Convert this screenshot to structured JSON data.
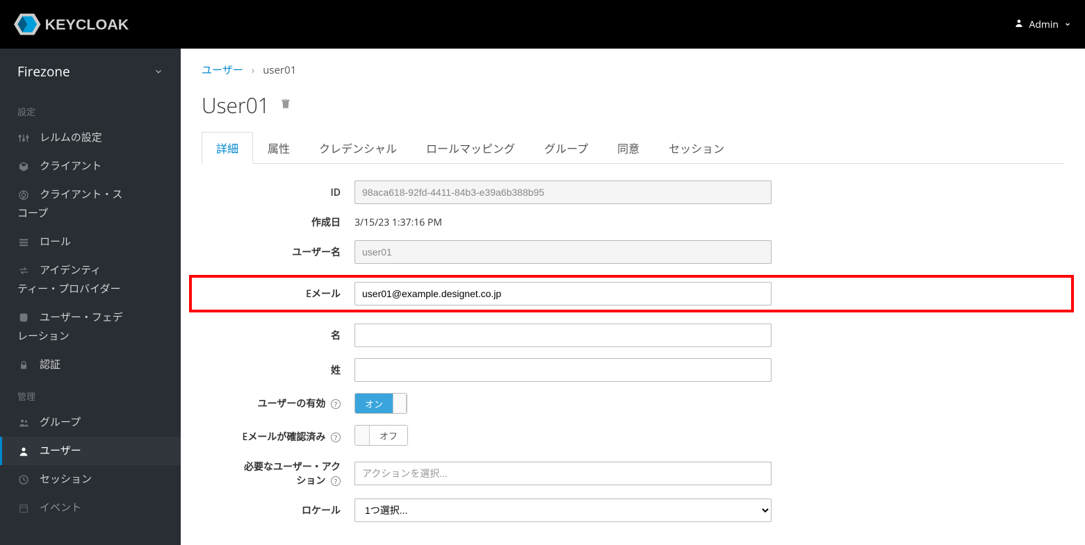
{
  "header": {
    "logo_text": "KEYCLOAK",
    "user_label": "Admin"
  },
  "sidebar": {
    "realm": "Firezone",
    "sections": [
      {
        "title": "設定",
        "items": [
          {
            "label": "レルムの設定",
            "icon": "sliders"
          },
          {
            "label": "クライアント",
            "icon": "cube"
          },
          {
            "label_l1": "クライアント・ス",
            "label_l2": "コープ",
            "icon": "globe"
          },
          {
            "label": "ロール",
            "icon": "list"
          },
          {
            "label_l1": "アイデンティ",
            "label_l2": "ティー・プロバイダー",
            "icon": "exchange"
          },
          {
            "label_l1": "ユーザー・フェデ",
            "label_l2": "レーション",
            "icon": "database"
          },
          {
            "label": "認証",
            "icon": "lock"
          }
        ]
      },
      {
        "title": "管理",
        "items": [
          {
            "label": "グループ",
            "icon": "users"
          },
          {
            "label": "ユーザー",
            "icon": "user",
            "active": true
          },
          {
            "label": "セッション",
            "icon": "clock"
          },
          {
            "label": "イベント",
            "icon": "calendar"
          }
        ]
      }
    ]
  },
  "breadcrumb": {
    "root": "ユーザー",
    "current": "user01"
  },
  "page": {
    "title": "User01",
    "tabs": [
      "詳細",
      "属性",
      "クレデンシャル",
      "ロールマッピング",
      "グループ",
      "同意",
      "セッション"
    ],
    "active_tab": 0
  },
  "form": {
    "id_label": "ID",
    "id_value": "98aca618-92fd-4411-84b3-e39a6b388b95",
    "created_label": "作成日",
    "created_value": "3/15/23 1:37:16 PM",
    "username_label": "ユーザー名",
    "username_value": "user01",
    "email_label": "Eメール",
    "email_value": "user01@example.designet.co.jp",
    "firstname_label": "名",
    "firstname_value": "",
    "lastname_label": "姓",
    "lastname_value": "",
    "enabled_label": "ユーザーの有効",
    "enabled_on": "オン",
    "email_verified_label": "Eメールが確認済み",
    "email_verified_off": "オフ",
    "required_actions_label_l1": "必要なユーザー・アク",
    "required_actions_label_l2": "ション",
    "required_actions_placeholder": "アクションを選択...",
    "locale_label": "ロケール",
    "locale_value": "1つ選択..."
  }
}
